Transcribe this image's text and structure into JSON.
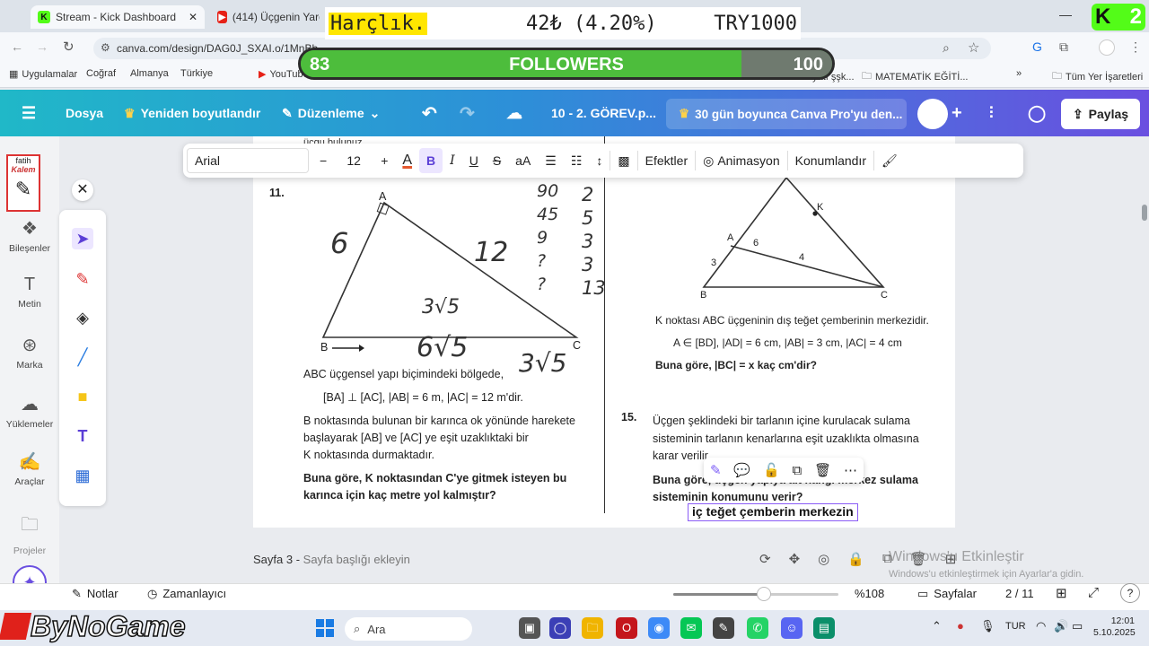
{
  "browser": {
    "tabs": [
      {
        "title": "Stream - Kick Dashboard",
        "favicon": "K"
      },
      {
        "title": "(414) Üçgenin Yardımcı",
        "favicon": "▶"
      }
    ],
    "url": "canva.com/design/DAG0J_SXAI.o/1MnBb...",
    "bookmarks": [
      "Uygulamalar",
      "Coğraf",
      "Almanya",
      "Türkiye",
      "YouTube",
      "Divan edebiyatı şşk...",
      "MATEMATİK EĞİTİ...",
      "Tüm Yer İşaretleri"
    ]
  },
  "overlay": {
    "harclik_label": "Harçlık.",
    "harclik_amount": "42₺ (4.20%)",
    "harclik_goal": "TRY1000",
    "followers_current": "83",
    "followers_label": "FOLLOWERS",
    "followers_goal": "100",
    "followers_progress": 0.83,
    "kick_badge_number": "2",
    "watermark_brand": "ByNoGame"
  },
  "canva_header": {
    "file_menu": "Dosya",
    "resize": "Yeniden boyutlandır",
    "edit_mode": "Düzenleme",
    "doc_title": "10 - 2. GÖREV.p...",
    "promo": "30 gün boyunca Canva Pro'yu den...",
    "share": "Paylaş"
  },
  "sidebar": {
    "items": [
      {
        "label": "Bileşenler",
        "icon": "elements-icon"
      },
      {
        "label": "Metin",
        "icon": "text-icon"
      },
      {
        "label": "Marka",
        "icon": "brand-icon"
      },
      {
        "label": "Yüklemeler",
        "icon": "upload-icon"
      },
      {
        "label": "Araçlar",
        "icon": "tools-icon"
      },
      {
        "label": "Projeler",
        "icon": "projects-icon"
      }
    ],
    "pen_sticker_name": "fatih",
    "pen_sticker_text": "Kalem"
  },
  "text_toolbar": {
    "font": "Arial",
    "size": "12",
    "effects": "Efektler",
    "animation": "Animasyon",
    "position": "Konumlandır"
  },
  "worksheet": {
    "q11_number": "11.",
    "q11_line1": "ABC üçgensel yapı biçimindeki bölgede,",
    "q11_line2": "[BA] ⊥ [AC],  |AB| = 6 m,  |AC| = 12 m'dir.",
    "q11_line3": "B noktasında bulunan bir karınca ok yönünde harekete",
    "q11_line4": "başlayarak [AB] ve [AC] ye eşit uzaklıktaki bir",
    "q11_line5": "K noktasında durmaktadır.",
    "q11_question": "Buna göre, K noktasından C'ye gitmek isteyen bu karınca için kaç metre yol kalmıştır?",
    "q11_labels": {
      "A": "A",
      "B": "B",
      "C": "C"
    },
    "hw_6": "6",
    "hw_12": "12",
    "hw_3sqrt5": "3√5",
    "hw_6sqrt5": "6√5",
    "hw_3sqrt5_b": "3√5",
    "hw_col1": "90\n45\n9\n?\n?",
    "hw_col2": "2\n5\n3\n3\n13",
    "q14_labels": {
      "A": "A",
      "B": "B",
      "C": "C",
      "K": "K",
      "side6": "6",
      "side3": "3",
      "side4": "4"
    },
    "q14_line1": "K noktası ABC üçgeninin dış teğet çemberinin merkezidir.",
    "q14_line2": "A ∈ [BD],  |AD| = 6 cm,  |AB| = 3 cm,  |AC| = 4 cm",
    "q14_question": "Buna göre, |BC| = x kaç cm'dir?",
    "q15_number": "15.",
    "q15_line1": "Üçgen şeklindeki bir tarlanın içine kurulacak sulama",
    "q15_line2": "sisteminin tarlanın kenarlarına eşit uzaklıkta olmasına",
    "q15_line3": "karar verilir.",
    "q15_question": "Buna göre, üçgen yapıya ait hangi merkez sulama sisteminin konumunu verir?",
    "q15_answer": "iç teğet çemberin merkezin",
    "partial_top_text": "üçgu bulunuz"
  },
  "page_footer": {
    "page_title": "Sayfa 3 -",
    "page_title_placeholder": "Sayfa başlığı ekleyin"
  },
  "activation": {
    "title": "Windows'u Etkinleştir",
    "subtitle": "Windows'u etkinleştirmek için Ayarlar'a gidin."
  },
  "bottom_bar": {
    "notes": "Notlar",
    "timer": "Zamanlayıcı",
    "zoom": "%108",
    "zoom_level": 0.55,
    "pages": "Sayfalar",
    "page_count": "2 / 11"
  },
  "taskbar": {
    "search": "Ara",
    "lang": "TUR",
    "time": "12:01",
    "date": "5.10.2025"
  }
}
